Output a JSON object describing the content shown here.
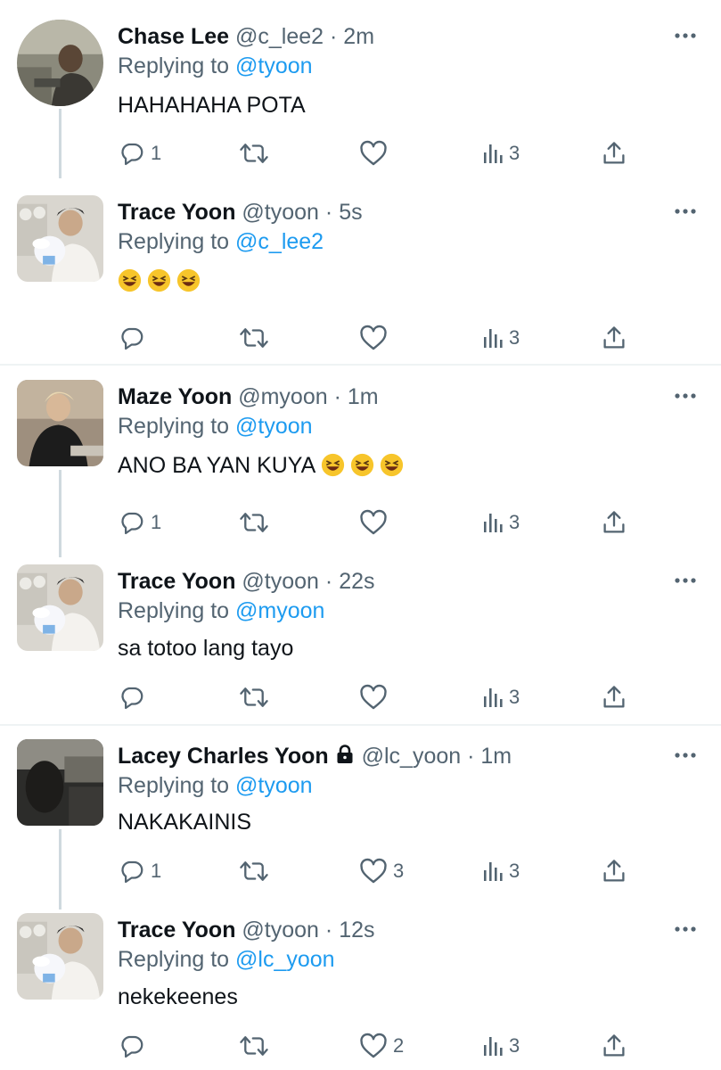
{
  "tweets": [
    {
      "name": "Chase Lee",
      "handle": "@c_lee2",
      "time": "2m",
      "replying_prefix": "Replying to",
      "replying_to": "@tyoon",
      "text": "HAHAHAHA POTA",
      "counts": {
        "reply": "1",
        "retweet": "",
        "like": "",
        "views": "3"
      },
      "avatar": "avatar-chase"
    },
    {
      "name": "Trace Yoon",
      "handle": "@tyoon",
      "time": "5s",
      "replying_prefix": "Replying to",
      "replying_to": "@c_lee2",
      "text": "",
      "emoji": [
        "laughing-emoji",
        "laughing-emoji",
        "laughing-emoji"
      ],
      "counts": {
        "reply": "",
        "retweet": "",
        "like": "",
        "views": "3"
      },
      "avatar": "avatar-trace"
    },
    {
      "name": "Maze Yoon",
      "handle": "@myoon",
      "time": "1m",
      "replying_prefix": "Replying to",
      "replying_to": "@tyoon",
      "text": "ANO BA YAN KUYA",
      "emoji": [
        "laughing-emoji",
        "laughing-emoji",
        "laughing-emoji"
      ],
      "counts": {
        "reply": "1",
        "retweet": "",
        "like": "",
        "views": "3"
      },
      "avatar": "avatar-maze"
    },
    {
      "name": "Trace Yoon",
      "handle": "@tyoon",
      "time": "22s",
      "replying_prefix": "Replying to",
      "replying_to": "@myoon",
      "text": "sa totoo lang tayo",
      "counts": {
        "reply": "",
        "retweet": "",
        "like": "",
        "views": "3"
      },
      "avatar": "avatar-trace"
    },
    {
      "name": "Lacey Charles Yoon",
      "handle": "@lc_yoon",
      "time": "1m",
      "protected": true,
      "replying_prefix": "Replying to",
      "replying_to": "@tyoon",
      "text": "NAKAKAINIS",
      "counts": {
        "reply": "1",
        "retweet": "",
        "like": "3",
        "views": "3"
      },
      "avatar": "avatar-lacey"
    },
    {
      "name": "Trace Yoon",
      "handle": "@tyoon",
      "time": "12s",
      "replying_prefix": "Replying to",
      "replying_to": "@lc_yoon",
      "text": "nekekeenes",
      "counts": {
        "reply": "",
        "retweet": "",
        "like": "2",
        "views": "3"
      },
      "avatar": "avatar-trace"
    }
  ],
  "separator": " · ",
  "icons": {
    "reply": "reply-icon",
    "retweet": "retweet-icon",
    "like": "like-icon",
    "views": "views-icon",
    "share": "share-icon",
    "more": "more-icon",
    "lock": "lock-icon"
  },
  "colors": {
    "text": "#0f1419",
    "secondary": "#536471",
    "accent": "#1d9bf0",
    "divider": "#eff3f4",
    "thread": "#cfd9de"
  }
}
